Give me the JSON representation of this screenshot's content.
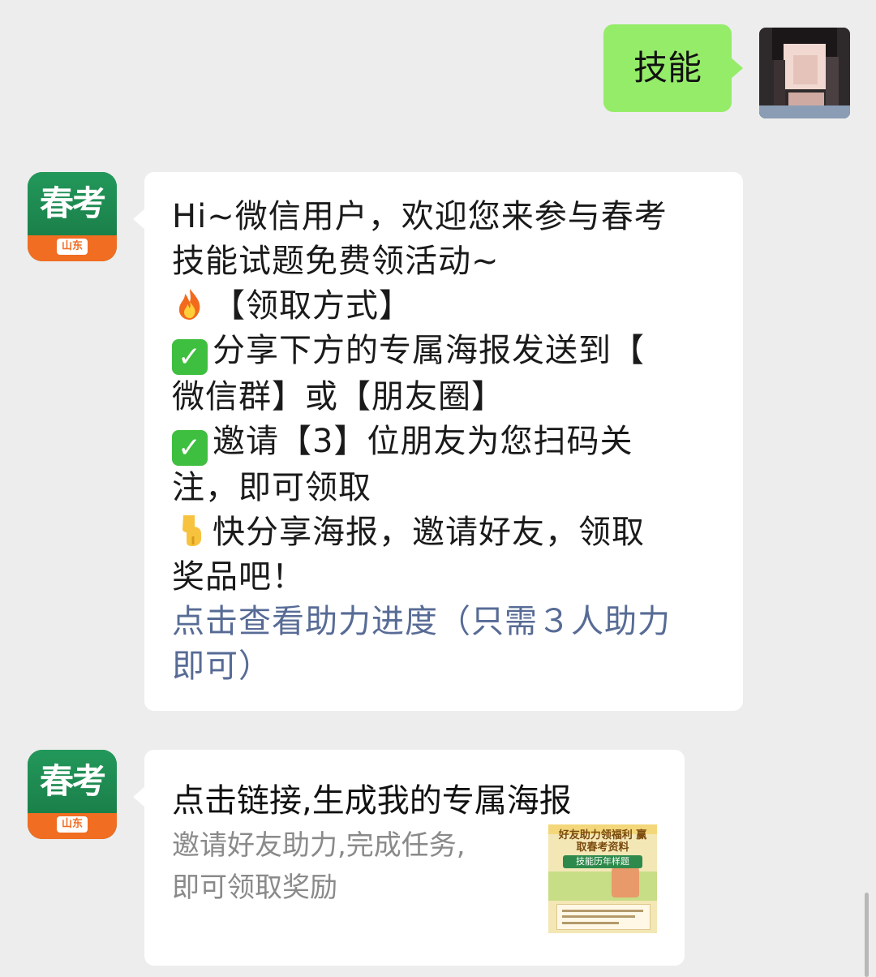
{
  "user_message": {
    "text": "技能"
  },
  "bot": {
    "avatar_main": "春考",
    "avatar_tag": "山东"
  },
  "welcome_message": {
    "lines": [
      "Hi~微信用户，欢迎您来参与春考",
      "技能试题免费领活动~",
      "【领取方式】",
      "分享下方的专属海报发送到【",
      "微信群】或【朋友圈】",
      "邀请【3】位朋友为您扫码关",
      "注，即可领取",
      "快分享海报，邀请好友，领取",
      "奖品吧！"
    ],
    "link_lines": [
      "点击查看助力进度（只需３人助力",
      "即可）"
    ],
    "emojis": [
      "fire-emoji",
      "check-mark-emoji",
      "check-mark-emoji",
      "pointing-down-emoji"
    ]
  },
  "link_card": {
    "title": "点击链接,生成我的专属海报",
    "desc_lines": [
      "邀请好友助力,完成任务,",
      "即可领取奖励"
    ],
    "thumb_top": "好友助力领福利 赢取春考资料",
    "thumb_badge": "技能历年样题"
  },
  "colors": {
    "background": "#ededed",
    "green_bubble": "#95ec69",
    "link": "#576b95",
    "avatar_green": "#1f8a52",
    "avatar_orange": "#f06d22"
  }
}
